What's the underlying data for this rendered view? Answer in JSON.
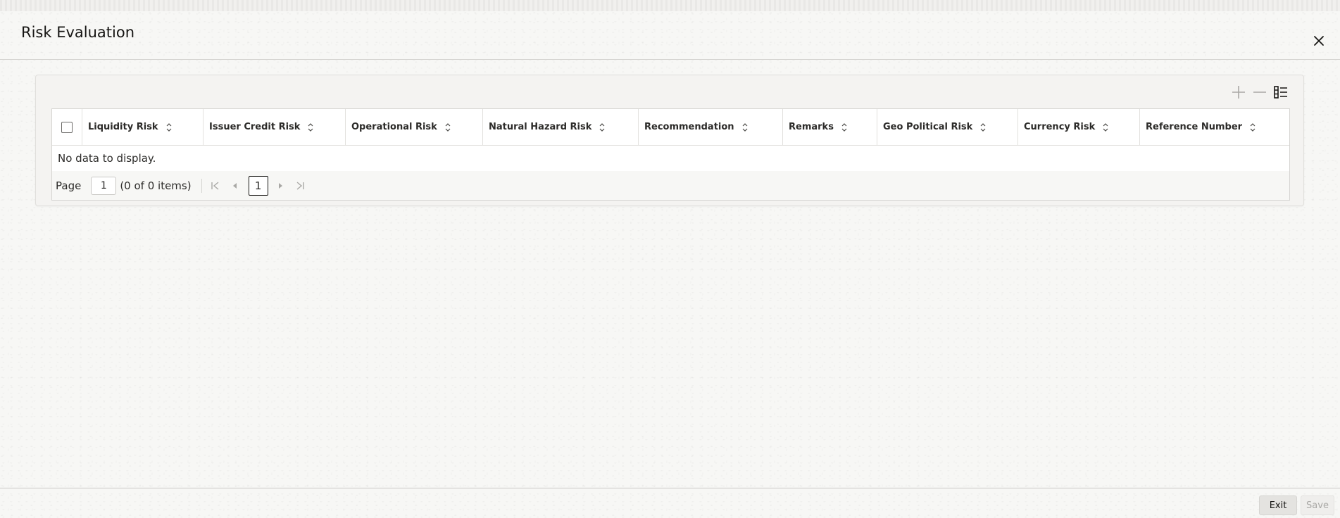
{
  "dialog": {
    "title": "Risk Evaluation"
  },
  "toolbar": {
    "icons": [
      "add-icon",
      "remove-icon",
      "column-settings-icon"
    ]
  },
  "grid": {
    "columns": [
      {
        "label": "Liquidity Risk"
      },
      {
        "label": "Issuer Credit Risk"
      },
      {
        "label": "Operational Risk"
      },
      {
        "label": "Natural Hazard Risk"
      },
      {
        "label": "Recommendation"
      },
      {
        "label": "Remarks"
      },
      {
        "label": "Geo Political Risk"
      },
      {
        "label": "Currency Risk"
      },
      {
        "label": "Reference Number"
      }
    ],
    "empty_message": "No data to display."
  },
  "pagination": {
    "page_label": "Page",
    "page_value": "1",
    "items_text": "(0 of 0 items)",
    "current_page": "1"
  },
  "footer": {
    "exit_label": "Exit",
    "save_label": "Save"
  },
  "colors": {
    "background": "#f7f7f5",
    "text": "#161513",
    "disabled_text": "#a9a8a5"
  }
}
